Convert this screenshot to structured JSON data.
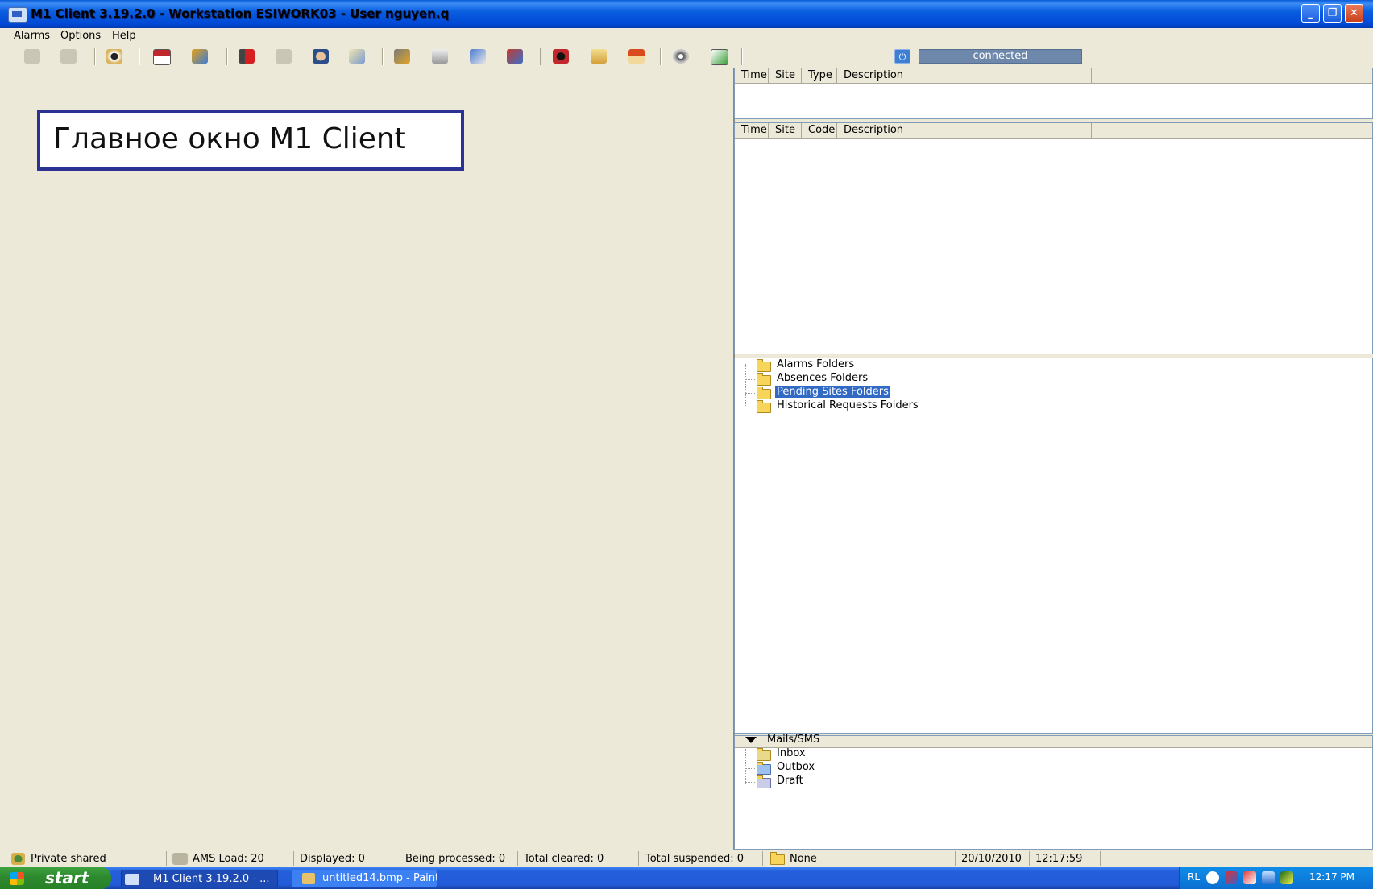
{
  "window": {
    "title": "M1 Client 3.19.2.0 - Workstation ESIWORK03 - User nguyen.q"
  },
  "menu": [
    "Alarms",
    "Options",
    "Help"
  ],
  "toolbar": {
    "icons": [
      "handshake-icon",
      "handshake-gray-icon",
      "eye-icon",
      "calendar-icon",
      "rocket-icon",
      "speaker-icon",
      "tag-icon",
      "person-icon",
      "notepad-icon",
      "car-key-icon",
      "layers-icon",
      "network-icon",
      "computer-icon",
      "car-icon",
      "mail-icon",
      "home-icon",
      "disc-icon",
      "edit-icon"
    ]
  },
  "connection": {
    "status": "connected",
    "color": "#6e88ab"
  },
  "callout": {
    "text": "Главное окно M1 Client"
  },
  "alarm_panel": {
    "columns": [
      "Time",
      "Site",
      "Type",
      "Description"
    ]
  },
  "event_panel": {
    "columns": [
      "Time",
      "Site",
      "Code",
      "Description"
    ]
  },
  "folders": {
    "items": [
      "Alarms Folders",
      "Absences Folders",
      "Pending Sites Folders",
      "Historical Requests Folders"
    ],
    "selected": "Pending Sites Folders"
  },
  "mails": {
    "title": "Mails/SMS",
    "items": [
      "Inbox",
      "Outbox",
      "Draft"
    ]
  },
  "statusbar": {
    "mode": "Private shared",
    "ams_load": "AMS Load: 20",
    "displayed": "Displayed: 0",
    "being_processed": "Being processed: 0",
    "total_cleared": "Total cleared: 0",
    "total_suspended": "Total suspended: 0",
    "folder": "None",
    "date": "20/10/2010",
    "time": "12:17:59"
  },
  "taskbar": {
    "start": "start",
    "tasks": [
      "M1 Client 3.19.2.0 - ...",
      "untitled14.bmp - Paint"
    ],
    "tray_lang": "RL",
    "clock": "12:17 PM"
  }
}
